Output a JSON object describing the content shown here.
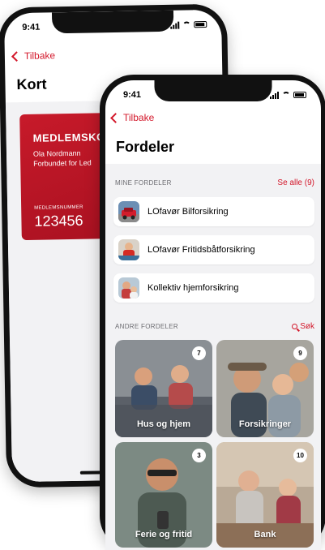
{
  "back_screen": {
    "status_time": "9:41",
    "back_label": "Tilbake",
    "title": "Kort",
    "card": {
      "title": "MEDLEMSKO",
      "name": "Ola Nordmann",
      "org": "Forbundet for Led",
      "number_label": "MEDLEMSNUMMER",
      "number": "123456"
    }
  },
  "front_screen": {
    "status_time": "9:41",
    "back_label": "Tilbake",
    "title": "Fordeler",
    "mine": {
      "header": "MINE FORDELER",
      "action": "Se alle (9)",
      "items": [
        {
          "label": "LOfavør Bilforsikring",
          "icon": "car-photo"
        },
        {
          "label": "LOfavør Fritidsbåtforsikring",
          "icon": "boat-photo"
        },
        {
          "label": "Kollektiv hjemforsikring",
          "icon": "home-photo"
        }
      ]
    },
    "andre": {
      "header": "ANDRE FORDELER",
      "action": "Søk",
      "tiles": [
        {
          "label": "Hus og hjem",
          "count": "7"
        },
        {
          "label": "Forsikringer",
          "count": "9"
        },
        {
          "label": "Ferie og fritid",
          "count": "3"
        },
        {
          "label": "Bank",
          "count": "10"
        }
      ]
    }
  },
  "colors": {
    "accent": "#d3172a",
    "card": "#c71a2a",
    "background": "#f2f2f4"
  }
}
